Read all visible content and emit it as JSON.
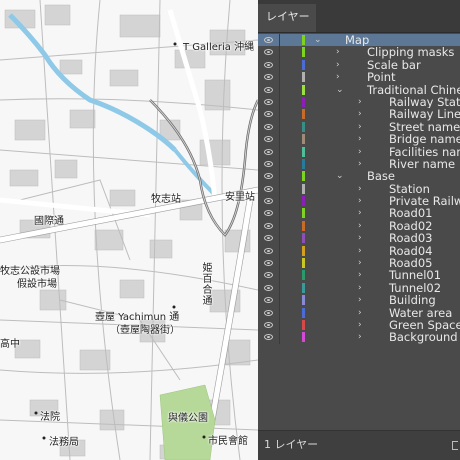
{
  "map": {
    "labels": [
      {
        "text": "T Galleria 沖縄",
        "name": "label-t-galleria"
      },
      {
        "text": "牧志站",
        "name": "label-makishi-station"
      },
      {
        "text": "安里站",
        "name": "label-asato-station"
      },
      {
        "text": "國際通",
        "name": "label-kokusai-dori"
      },
      {
        "text": "牧志公設市場",
        "name": "label-makishi-market"
      },
      {
        "text": "假設市場",
        "name": "label-temporary-market"
      },
      {
        "text": "壺屋 Yachimun 通",
        "name": "label-yachimun-dori"
      },
      {
        "text": "（壺屋陶器街）",
        "name": "label-pottery-street"
      },
      {
        "text": "姫百合通",
        "name": "label-himeyuri-dori"
      },
      {
        "text": "法院",
        "name": "label-court"
      },
      {
        "text": "法務局",
        "name": "label-legal-affairs-bureau"
      },
      {
        "text": "與儀公園",
        "name": "label-yogi-park"
      },
      {
        "text": "市民會館",
        "name": "label-civic-hall"
      },
      {
        "text": "高中",
        "name": "label-high-school"
      }
    ]
  },
  "panel": {
    "tab_label": "レイヤー",
    "footer_label": "1 レイヤー",
    "layers": [
      {
        "name": "Map",
        "indent": 0,
        "expanded": true,
        "selected": true,
        "color": "#7ed321"
      },
      {
        "name": "Clipping masks",
        "indent": 1,
        "expanded": false,
        "color": "#7ed321"
      },
      {
        "name": "Scale bar",
        "indent": 1,
        "expanded": false,
        "color": "#4a6cd4"
      },
      {
        "name": "Point",
        "indent": 1,
        "expanded": false,
        "color": "#b0b0b0"
      },
      {
        "name": "Traditional Chinese",
        "indent": 1,
        "expanded": true,
        "color": "#9be040"
      },
      {
        "name": "Railway Station",
        "indent": 2,
        "expanded": false,
        "color": "#8b1fb8"
      },
      {
        "name": "Railway Line",
        "indent": 2,
        "expanded": false,
        "color": "#c86a2a"
      },
      {
        "name": "Street name",
        "indent": 2,
        "expanded": false,
        "color": "#3a8d86"
      },
      {
        "name": "Bridge name",
        "indent": 2,
        "expanded": false,
        "color": "#a08a78"
      },
      {
        "name": "Facilities name",
        "indent": 2,
        "expanded": false,
        "color": "#4fbf9a"
      },
      {
        "name": "River name",
        "indent": 2,
        "expanded": false,
        "color": "#2a7a9a"
      },
      {
        "name": "Base",
        "indent": 1,
        "expanded": true,
        "color": "#7ed321"
      },
      {
        "name": "Station",
        "indent": 2,
        "expanded": false,
        "color": "#b0b0b0"
      },
      {
        "name": "Private Railway",
        "indent": 2,
        "expanded": false,
        "color": "#8b1fb8"
      },
      {
        "name": "Road01",
        "indent": 2,
        "expanded": false,
        "color": "#7ed321"
      },
      {
        "name": "Road02",
        "indent": 2,
        "expanded": false,
        "color": "#c86a2a"
      },
      {
        "name": "Road03",
        "indent": 2,
        "expanded": false,
        "color": "#8b4fb8"
      },
      {
        "name": "Road04",
        "indent": 2,
        "expanded": false,
        "color": "#d4a020"
      },
      {
        "name": "Road05",
        "indent": 2,
        "expanded": false,
        "color": "#c8c820"
      },
      {
        "name": "Tunnel01",
        "indent": 2,
        "expanded": false,
        "color": "#2a9a6a"
      },
      {
        "name": "Tunnel02",
        "indent": 2,
        "expanded": false,
        "color": "#3a9a9a"
      },
      {
        "name": "Building",
        "indent": 2,
        "expanded": false,
        "color": "#8a8ad4"
      },
      {
        "name": "Water area",
        "indent": 2,
        "expanded": false,
        "color": "#4a6cd4"
      },
      {
        "name": "Green Space",
        "indent": 2,
        "expanded": false,
        "color": "#d44a4a"
      },
      {
        "name": "Background",
        "indent": 2,
        "expanded": false,
        "color": "#d44ad4"
      }
    ]
  }
}
